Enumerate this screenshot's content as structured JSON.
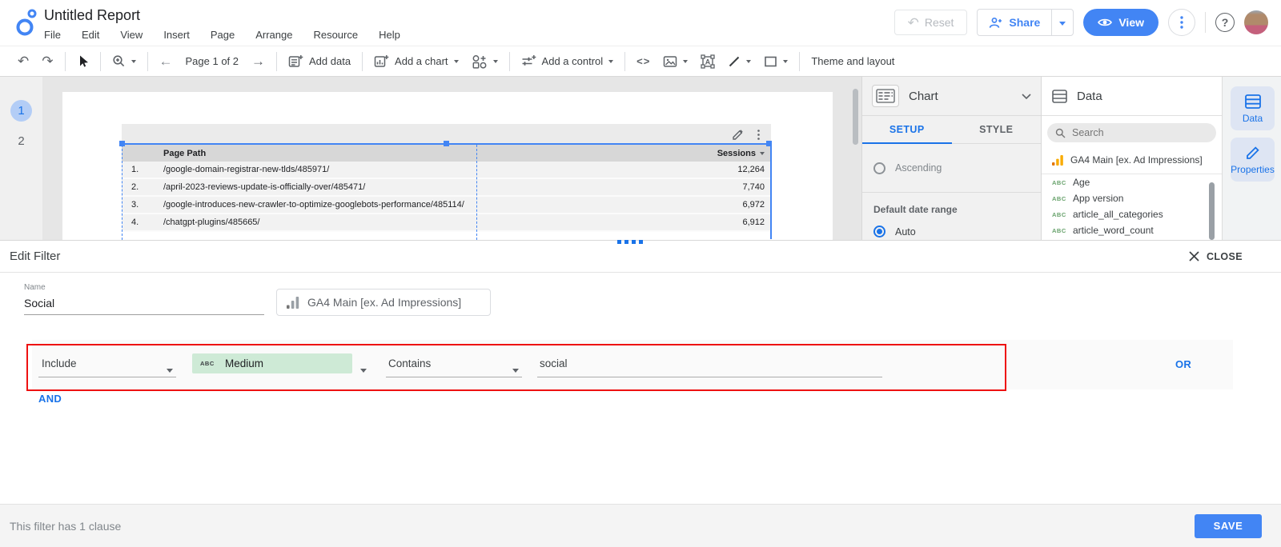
{
  "topbar": {
    "title": "Untitled Report",
    "menus": [
      "File",
      "Edit",
      "View",
      "Insert",
      "Page",
      "Arrange",
      "Resource",
      "Help"
    ],
    "reset_label": "Reset",
    "share_label": "Share",
    "view_label": "View",
    "help_glyph": "?"
  },
  "toolbar": {
    "page_nav": "Page 1 of 2",
    "add_data_label": "Add data",
    "add_chart_label": "Add a chart",
    "add_control_label": "Add a control",
    "code_glyph": "<>",
    "theme_label": "Theme and layout"
  },
  "pages": [
    "1",
    "2"
  ],
  "canvas_table": {
    "columns": [
      "Page Path",
      "Sessions"
    ],
    "rows": [
      {
        "n": "1.",
        "path": "/google-domain-registrar-new-tlds/485971/",
        "sessions": "12,264"
      },
      {
        "n": "2.",
        "path": "/april-2023-reviews-update-is-officially-over/485471/",
        "sessions": "7,740"
      },
      {
        "n": "3.",
        "path": "/google-introduces-new-crawler-to-optimize-googlebots-performance/485114/",
        "sessions": "6,972"
      },
      {
        "n": "4.",
        "path": "/chatgpt-plugins/485665/",
        "sessions": "6,912"
      }
    ]
  },
  "chart_panel": {
    "title": "Chart",
    "tabs": [
      "SETUP",
      "STYLE"
    ],
    "sort_option": "Ascending",
    "date_range_label": "Default date range",
    "date_range_value": "Auto"
  },
  "data_panel": {
    "title": "Data",
    "search_placeholder": "Search",
    "source": "GA4 Main [ex. Ad Impressions]",
    "field_type_badge": "ABC",
    "fields": [
      "Age",
      "App version",
      "article_all_categories",
      "article_word_count"
    ]
  },
  "right_rail": {
    "data_label": "Data",
    "properties_label": "Properties"
  },
  "filter_panel": {
    "title": "Edit Filter",
    "close_label": "CLOSE",
    "name_label": "Name",
    "name_value": "Social",
    "source": "GA4 Main [ex. Ad Impressions]",
    "clause": {
      "operator": "Include",
      "field_badge": "ABC",
      "field": "Medium",
      "condition": "Contains",
      "value": "social",
      "or_label": "OR",
      "and_label": "AND"
    },
    "footer_status": "This filter has 1 clause",
    "save_label": "SAVE"
  },
  "colors": {
    "accent_blue": "#1a73e8",
    "button_blue": "#4285f4",
    "selection_blue": "#4285f4",
    "annotation_red": "#ee1111",
    "field_chip_green": "#ceead6",
    "abc_green": "#69a36d",
    "ga_orange": "#f9ab00",
    "ga_orange_dark": "#e37400"
  }
}
